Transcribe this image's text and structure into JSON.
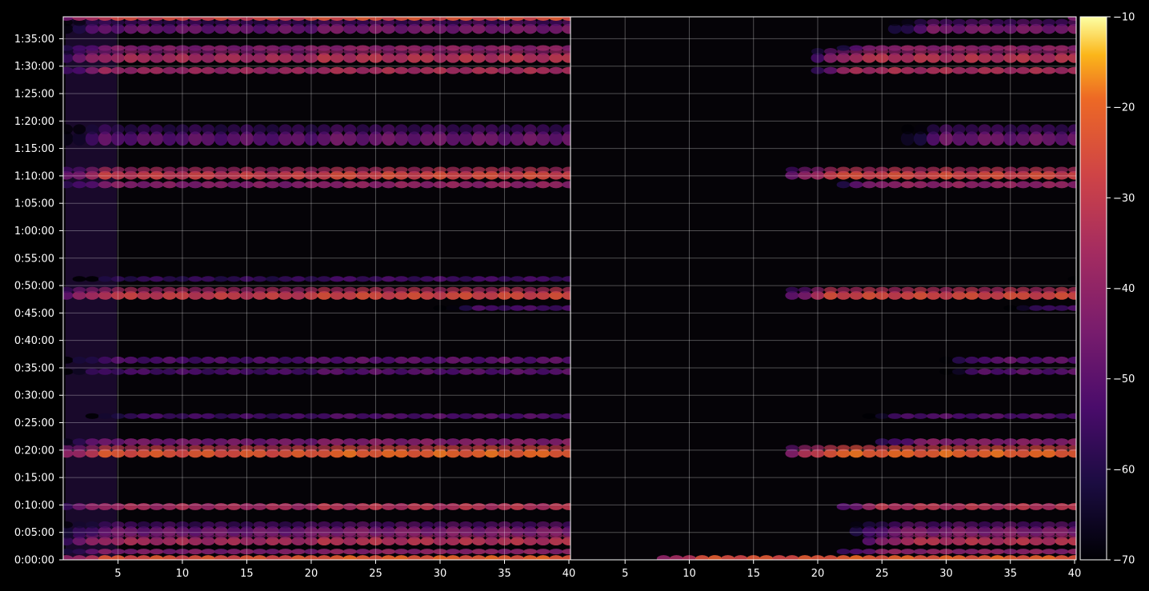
{
  "chart_data": {
    "type": "heatmap",
    "title": "",
    "xlabel": "",
    "ylabel": "",
    "panels": [
      {
        "name": "",
        "xlim": [
          1,
          40
        ],
        "x_ticks": [
          5,
          10,
          15,
          20,
          25,
          30,
          35,
          40
        ],
        "x_tick_labels": [
          "5",
          "10",
          "15",
          "20",
          "25",
          "30",
          "35",
          "40"
        ]
      },
      {
        "name": "",
        "xlim": [
          1,
          40
        ],
        "x_ticks": [
          5,
          10,
          15,
          20,
          25,
          30,
          35,
          40
        ],
        "x_tick_labels": [
          "5",
          "10",
          "15",
          "20",
          "25",
          "30",
          "35",
          "40"
        ]
      }
    ],
    "y_unit": "elapsed time (h:mm:ss)",
    "ylim_minutes": [
      0,
      99
    ],
    "y_ticks_minutes": [
      0,
      5,
      10,
      15,
      20,
      25,
      30,
      35,
      40,
      45,
      50,
      55,
      60,
      65,
      70,
      75,
      80,
      85,
      90,
      95
    ],
    "y_tick_labels": [
      "0:00:00",
      "0:05:00",
      "0:10:00",
      "0:15:00",
      "0:20:00",
      "0:25:00",
      "0:30:00",
      "0:35:00",
      "0:40:00",
      "0:45:00",
      "0:50:00",
      "0:55:00",
      "1:00:00",
      "1:05:00",
      "1:10:00",
      "1:15:00",
      "1:20:00",
      "1:25:00",
      "1:30:00",
      "1:35:00"
    ],
    "grid": true,
    "colormap": "inferno",
    "colorbar": {
      "range": [
        -70,
        -10
      ],
      "ticks": [
        -10,
        -20,
        -30,
        -40,
        -50,
        -60,
        -70
      ],
      "tick_labels": [
        "−10",
        "−20",
        "−30",
        "−40",
        "−50",
        "−60",
        "−70"
      ]
    },
    "activity_bands": [
      {
        "t_minutes": 0.2,
        "level": -25,
        "thickness": 1.0,
        "left_start": 1,
        "right_start": 8
      },
      {
        "t_minutes": 1.5,
        "level": -44,
        "thickness": 0.8,
        "left_start": 1,
        "right_start": 22
      },
      {
        "t_minutes": 3.4,
        "level": -36,
        "thickness": 1.2,
        "left_start": 1,
        "right_start": 24
      },
      {
        "t_minutes": 5.2,
        "level": -47,
        "thickness": 1.4,
        "left_start": 1,
        "right_start": 23
      },
      {
        "t_minutes": 9.7,
        "level": -36,
        "thickness": 1.0,
        "left_start": 1,
        "right_start": 22
      },
      {
        "t_minutes": 19.4,
        "level": -24,
        "thickness": 1.2,
        "left_start": 1,
        "right_start": 18
      },
      {
        "t_minutes": 21.5,
        "level": -46,
        "thickness": 1.0,
        "left_start": 1,
        "right_start": 25
      },
      {
        "t_minutes": 26.2,
        "level": -55,
        "thickness": 0.8,
        "left_start": 3,
        "right_start": 24
      },
      {
        "t_minutes": 34.3,
        "level": -54,
        "thickness": 0.9,
        "left_start": 1,
        "right_start": 30
      },
      {
        "t_minutes": 36.4,
        "level": -53,
        "thickness": 1.0,
        "left_start": 1,
        "right_start": 30
      },
      {
        "t_minutes": 45.9,
        "level": -57,
        "thickness": 0.8,
        "left_start": 30,
        "right_start": 35
      },
      {
        "t_minutes": 48.2,
        "level": -30,
        "thickness": 1.2,
        "left_start": 1,
        "right_start": 18
      },
      {
        "t_minutes": 51.2,
        "level": -58,
        "thickness": 0.8,
        "left_start": 2,
        "right_start": 40
      },
      {
        "t_minutes": 68.4,
        "level": -43,
        "thickness": 1.0,
        "left_start": 1,
        "right_start": 22
      },
      {
        "t_minutes": 70.1,
        "level": -30,
        "thickness": 1.2,
        "left_start": 1,
        "right_start": 18
      },
      {
        "t_minutes": 76.8,
        "level": -50,
        "thickness": 2.0,
        "left_start": 1,
        "right_start": 27
      },
      {
        "t_minutes": 89.2,
        "level": -38,
        "thickness": 1.0,
        "left_start": 1,
        "right_start": 20
      },
      {
        "t_minutes": 91.5,
        "level": -36,
        "thickness": 1.4,
        "left_start": 1,
        "right_start": 20
      },
      {
        "t_minutes": 93.3,
        "level": -44,
        "thickness": 0.8,
        "left_start": 1,
        "right_start": 22
      },
      {
        "t_minutes": 96.8,
        "level": -48,
        "thickness": 1.4,
        "left_start": 1,
        "right_start": 26
      },
      {
        "t_minutes": 98.8,
        "level": -28,
        "thickness": 0.8,
        "left_start": 1,
        "right_start": 40
      }
    ]
  }
}
